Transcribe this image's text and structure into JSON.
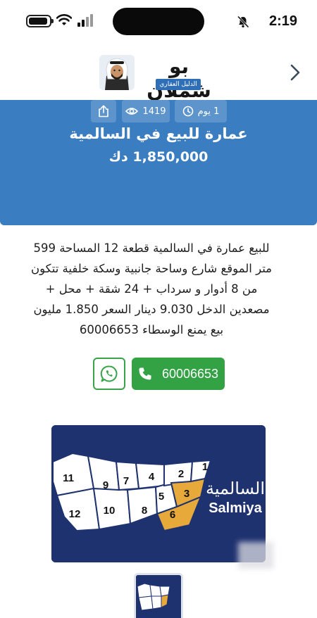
{
  "status_bar": {
    "time": "2:19"
  },
  "header": {
    "logo_title": "بو شملان",
    "logo_subtitle": "الدليل العقاري"
  },
  "listing": {
    "title": "عمارة للبيع في السالمية",
    "price": "1,850,000 دك",
    "posted": "1 يوم",
    "views": "1419",
    "description": "للبيع عمارة في السالمية قطعة 12 المساحة 599 متر الموقع شارع وساحة جانبية وسكة خلفية تتكون من 8 أدوار و سرداب + 24 شقة + محل + مصعدين الدخل 9.030 دينار السعر 1.850 مليون بيع يمنع الوسطاء 60006653"
  },
  "contact": {
    "phone": "60006653"
  },
  "map": {
    "label_ar": "السالمية",
    "label_en": "Salmiya",
    "blocks": [
      "1",
      "2",
      "3",
      "4",
      "5",
      "6",
      "7",
      "8",
      "9",
      "10",
      "11",
      "12"
    ],
    "highlighted_blocks": [
      "3",
      "6"
    ],
    "colors": {
      "background": "#1f3270",
      "block": "#ffffff",
      "highlight": "#e7a93a"
    }
  },
  "colors": {
    "card_blue": "#3a7dc0",
    "whatsapp_green": "#3aa34a",
    "call_green": "#33a245"
  },
  "icons": {
    "back": "chevron-right-icon",
    "time": "clock-icon",
    "views": "eye-icon",
    "share": "share-icon",
    "whatsapp": "whatsapp-icon",
    "phone": "phone-icon"
  }
}
